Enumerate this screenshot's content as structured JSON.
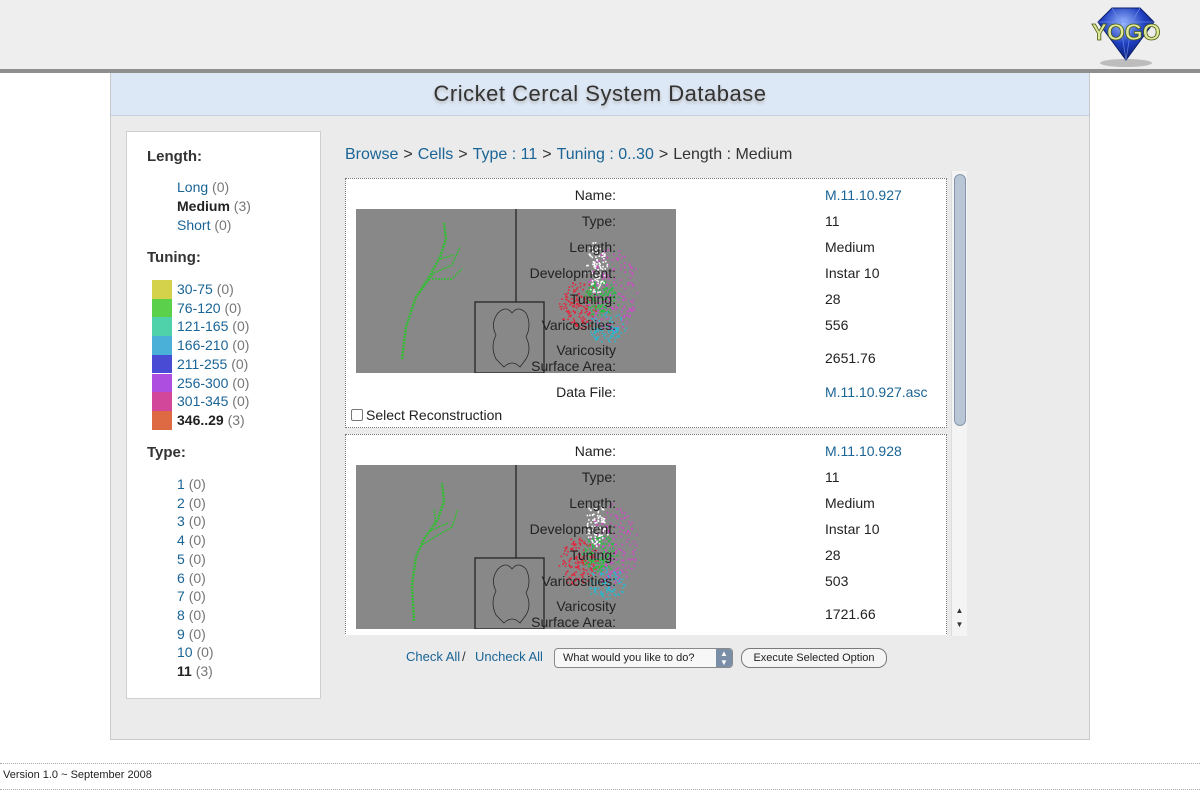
{
  "header": {
    "logo_text": "YOGO"
  },
  "title": "Cricket Cercal System Database",
  "sidebar": {
    "length": {
      "heading": "Length:",
      "items": [
        {
          "label": "Long",
          "count": "(0)",
          "selected": false
        },
        {
          "label": "Medium",
          "count": "(3)",
          "selected": true
        },
        {
          "label": "Short",
          "count": "(0)",
          "selected": false
        }
      ]
    },
    "tuning": {
      "heading": "Tuning:",
      "items": [
        {
          "label": "30-75",
          "count": "(0)",
          "color": "#d4d24a",
          "selected": false
        },
        {
          "label": "76-120",
          "count": "(0)",
          "color": "#5bd04b",
          "selected": false
        },
        {
          "label": "121-165",
          "count": "(0)",
          "color": "#4fd2a9",
          "selected": false
        },
        {
          "label": "166-210",
          "count": "(0)",
          "color": "#4bb0d8",
          "selected": false
        },
        {
          "label": "211-255",
          "count": "(0)",
          "color": "#4a4bd4",
          "selected": false
        },
        {
          "label": "256-300",
          "count": "(0)",
          "color": "#ae4ee0",
          "selected": false
        },
        {
          "label": "301-345",
          "count": "(0)",
          "color": "#d2479a",
          "selected": false
        },
        {
          "label": "346..29",
          "count": "(3)",
          "color": "#de6a44",
          "selected": true
        }
      ]
    },
    "type": {
      "heading": "Type:",
      "items": [
        {
          "label": "1",
          "count": "(0)",
          "selected": false
        },
        {
          "label": "2",
          "count": "(0)",
          "selected": false
        },
        {
          "label": "3",
          "count": "(0)",
          "selected": false
        },
        {
          "label": "4",
          "count": "(0)",
          "selected": false
        },
        {
          "label": "5",
          "count": "(0)",
          "selected": false
        },
        {
          "label": "6",
          "count": "(0)",
          "selected": false
        },
        {
          "label": "7",
          "count": "(0)",
          "selected": false
        },
        {
          "label": "8",
          "count": "(0)",
          "selected": false
        },
        {
          "label": "9",
          "count": "(0)",
          "selected": false
        },
        {
          "label": "10",
          "count": "(0)",
          "selected": false
        },
        {
          "label": "11",
          "count": "(3)",
          "selected": true
        }
      ]
    }
  },
  "breadcrumb": {
    "separator": ">",
    "items": [
      {
        "label": "Browse",
        "link": true
      },
      {
        "label": "Cells",
        "link": true
      },
      {
        "label": "Type : 11",
        "link": true
      },
      {
        "label": "Tuning : 0..30",
        "link": true
      },
      {
        "label": "Length : Medium",
        "link": false
      }
    ]
  },
  "labels": {
    "name": "Name:",
    "type": "Type:",
    "length": "Length:",
    "development": "Development:",
    "tuning": "Tuning:",
    "varicosities": "Varicosities:",
    "surface_area_line1": "Varicosity",
    "surface_area_line2": "Surface Area:",
    "data_file": "Data File:"
  },
  "results": [
    {
      "name": "M.11.10.927",
      "type": "11",
      "length": "Medium",
      "development": "Instar 10",
      "tuning": "28",
      "varicosities": "556",
      "surface_area": "2651.76",
      "data_file": "M.11.10.927.asc",
      "select_label": "Select Reconstruction",
      "checked": false
    },
    {
      "name": "M.11.10.928",
      "type": "11",
      "length": "Medium",
      "development": "Instar 10",
      "tuning": "28",
      "varicosities": "503",
      "surface_area": "1721.66",
      "data_file": "",
      "select_label": "",
      "checked": false
    }
  ],
  "scrollbar": {
    "up_arrow": "▲",
    "down_arrow": "▼"
  },
  "actions": {
    "check_all": "Check All",
    "slash": "/",
    "uncheck_all": "Uncheck All",
    "select_placeholder": "What would you like to do?",
    "execute_label": "Execute Selected Option"
  },
  "footer": {
    "version": "Version 1.0 ~ September 2008"
  },
  "colors": {
    "link": "#1a6496",
    "title_bar": "#dde8f6",
    "thumbnail_bg": "#888888",
    "neuron_main": "#2ec02e",
    "cluster_red": "#e0283c",
    "cluster_green": "#22c040",
    "cluster_magenta": "#d048c8",
    "cluster_cyan": "#28b8d0",
    "cluster_white": "#ffffff"
  }
}
